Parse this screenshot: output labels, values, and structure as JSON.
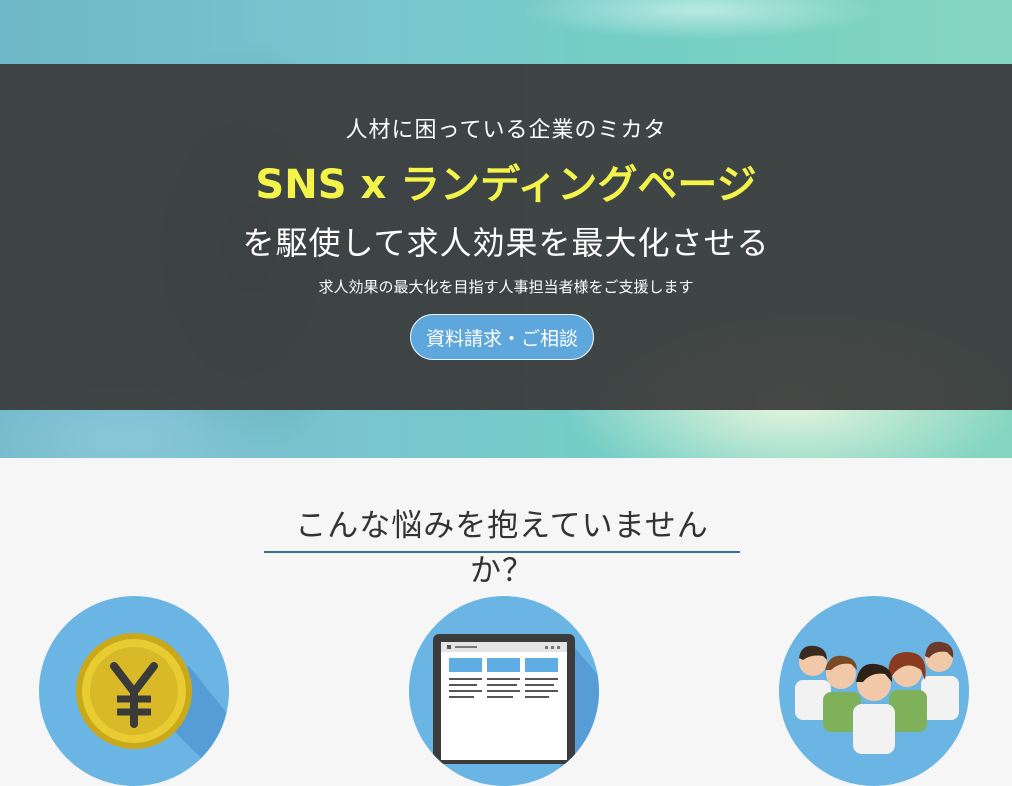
{
  "hero": {
    "tagline": "人材に困っている企業のミカタ",
    "headline": "SNS x ランディングページ",
    "subhead": "を駆使して求人効果を最大化させる",
    "small_copy": "求人効果の最大化を目指す人事担当者様をご支援します",
    "cta_label": "資料請求・ご相談"
  },
  "worries": {
    "title": "こんな悩みを抱えていませんか？",
    "icons": [
      "yen-coin-icon",
      "browser-window-icon",
      "people-group-icon"
    ]
  },
  "colors": {
    "headline": "#f3f34a",
    "cta": "#5ea7dd",
    "icon_circle": "#6ab5e3",
    "underline": "#3d6f8e"
  }
}
